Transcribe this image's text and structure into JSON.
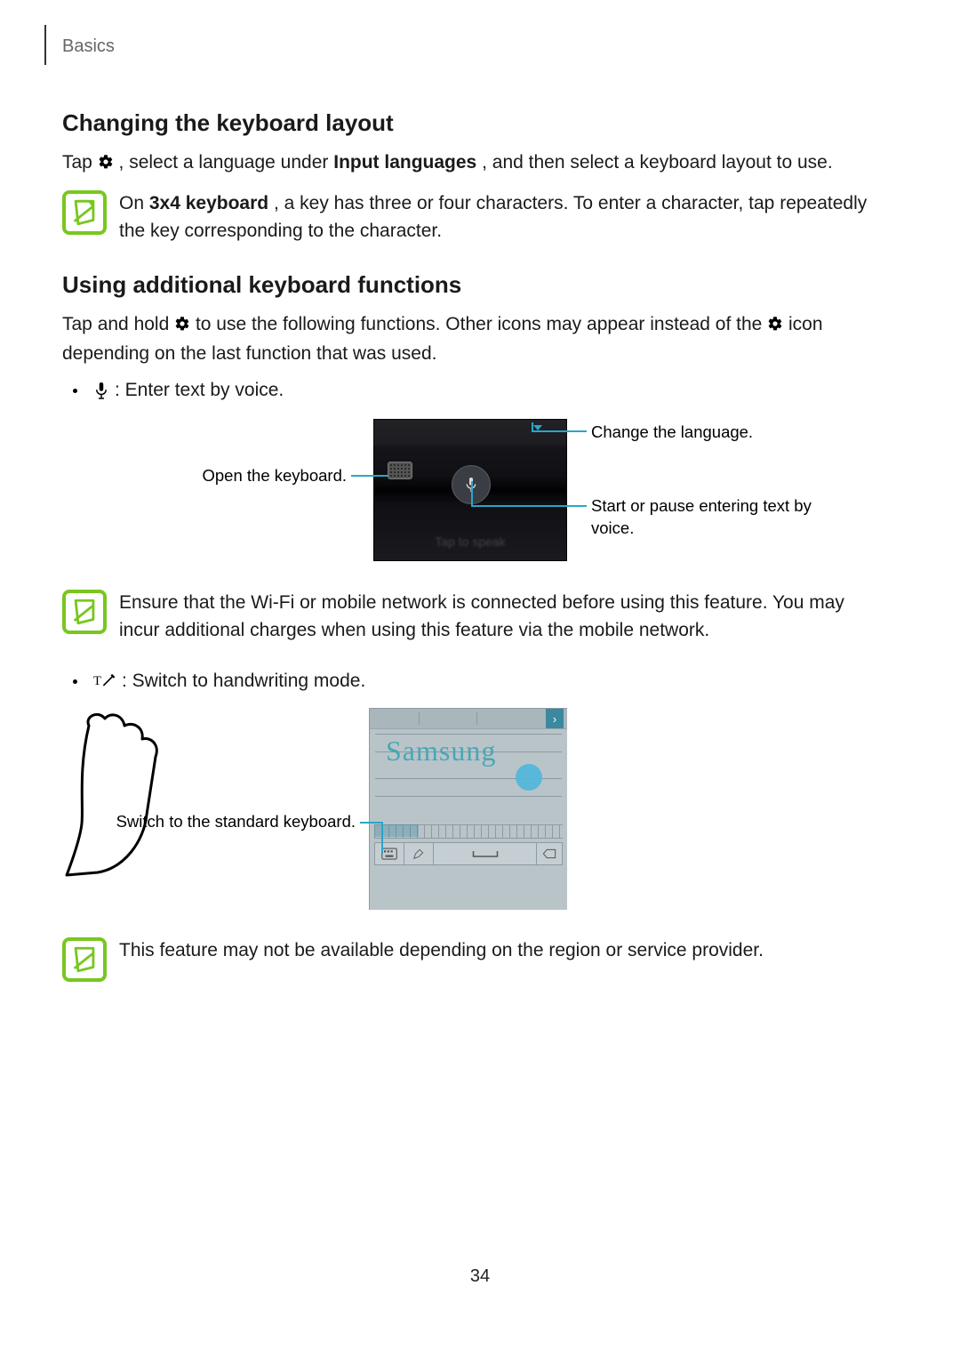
{
  "running_head": "Basics",
  "page_number": "34",
  "section1": {
    "heading": "Changing the keyboard layout",
    "para_before_icon": "Tap ",
    "para_after_icon_before_bold": ", select a language under ",
    "bold": "Input languages",
    "para_after_bold": ", and then select a keyboard layout to use.",
    "note_before_bold": "On ",
    "note_bold": "3x4 keyboard",
    "note_after_bold": ", a key has three or four characters. To enter a character, tap repeatedly the key corresponding to the character."
  },
  "section2": {
    "heading": "Using additional keyboard functions",
    "p1_a": "Tap and hold ",
    "p1_b": " to use the following functions. Other icons may appear instead of the ",
    "p1_c": " icon depending on the last function that was used.",
    "bullet_voice": " : Enter text by voice.",
    "fig_voice": {
      "callout_left": "Open the keyboard.",
      "callout_top_right": "Change the language.",
      "callout_bottom_right": "Start or pause entering text by voice.",
      "speak_prompt": "Tap to speak"
    },
    "note_wifi": "Ensure that the Wi-Fi or mobile network is connected before using this feature. You may incur additional charges when using this feature via the mobile network.",
    "bullet_hand": " : Switch to handwriting mode.",
    "fig_hand": {
      "callout_left": "Switch to the standard keyboard.",
      "written": "Samsung",
      "suggest_chev": "›"
    },
    "note_region": "This feature may not be available depending on the region or service provider."
  }
}
